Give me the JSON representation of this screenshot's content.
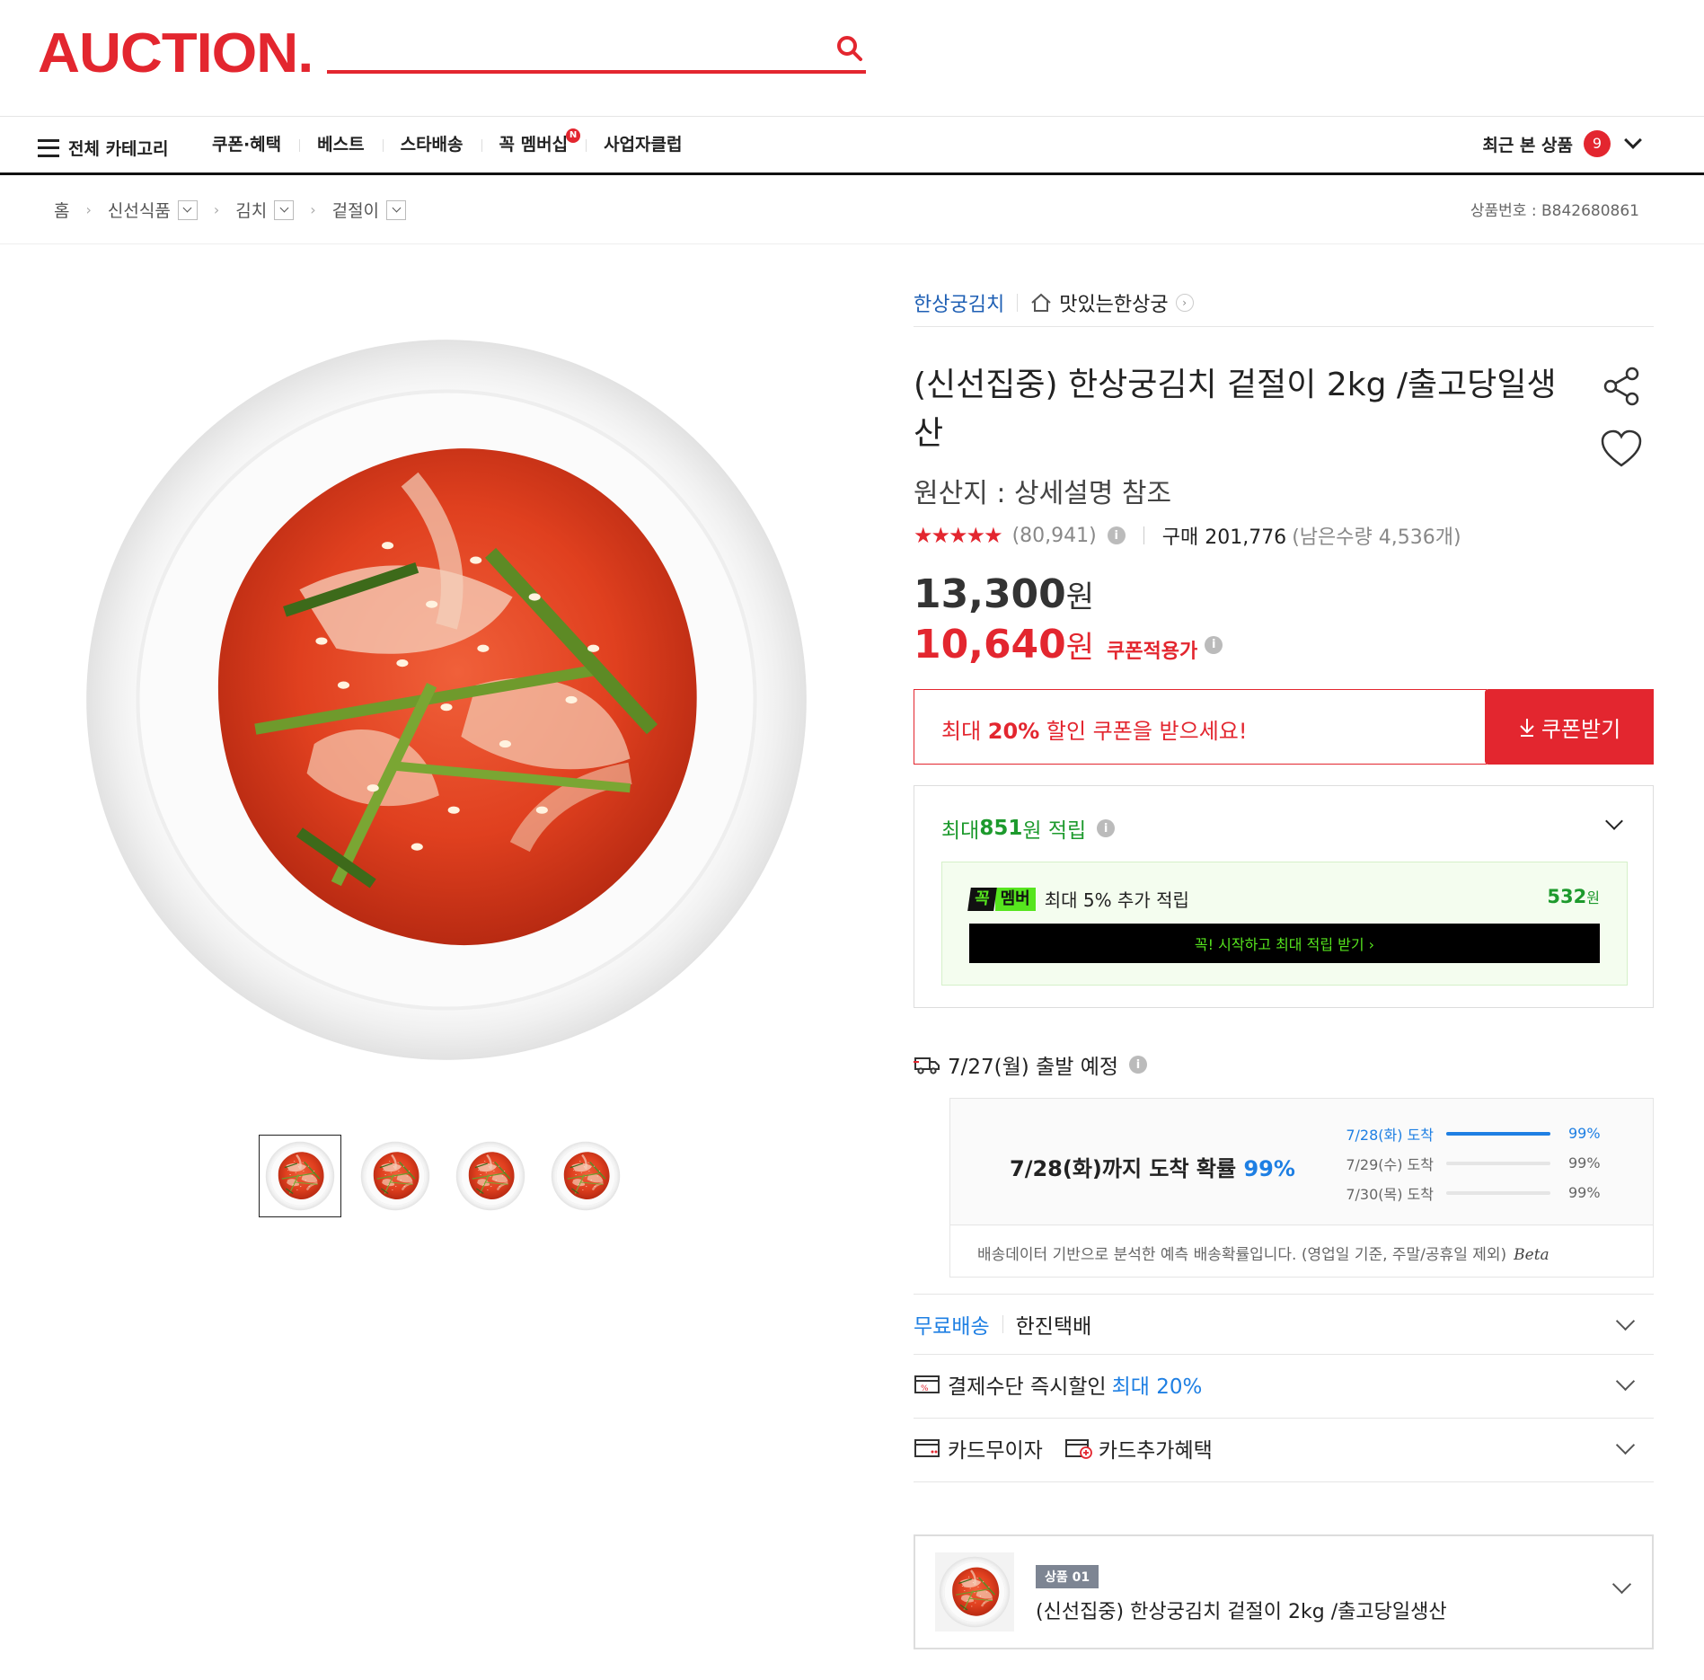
{
  "header": {
    "logo": "AUCTION.",
    "search_placeholder": "",
    "search_icon": "search-icon",
    "brand_color": "#e3262f"
  },
  "nav": {
    "all_category": "전체 카테고리",
    "items": [
      {
        "label": "쿠폰·혜택"
      },
      {
        "label": "베스트"
      },
      {
        "label": "스타배송"
      },
      {
        "label": "꼭 멤버십",
        "badge": "N"
      },
      {
        "label": "사업자클럽"
      }
    ],
    "recent_label": "최근 본 상품",
    "recent_count": "9"
  },
  "breadcrumb": {
    "items": [
      "홈",
      "신선식품",
      "김치",
      "겉절이"
    ],
    "product_no_label": "상품번호 : B842680861"
  },
  "gallery": {
    "thumbnail_count": 4
  },
  "product": {
    "brand": "한상궁김치",
    "store": "맛있는한상궁",
    "title": "(신선집중) 한상궁김치 겉절이 2kg /출고당일생산",
    "origin": "원산지 : 상세설명 참조",
    "stars": "★★★★★",
    "rating": 4.8,
    "review_count": "(80,941)",
    "buy_label": "구매 201,776",
    "remain_label": "(남은수량 4,536개)",
    "original_price": "13,300",
    "sale_price": "10,640",
    "won": "원",
    "coupon_price_label": "쿠폰적용가"
  },
  "coupon": {
    "msg_pre": "최대 ",
    "msg_bold": "20%",
    "msg_post": " 할인 쿠폰을 받으세요!",
    "button": "쿠폰받기"
  },
  "points": {
    "pre": "최대 ",
    "amount": "851",
    "post": "원 적립",
    "member_logo_a": "꼭",
    "member_logo_b": "멤버",
    "member_text": "최대 5% 추가 적립",
    "member_amount": "532",
    "member_won": "원",
    "member_button": "꼭! 시작하고 최대 적립 받기 ›"
  },
  "shipping": {
    "depart": "7/27(월) 출발 예정",
    "main_pre": "7/28(화)까지 도착 확률 ",
    "main_pct": "99%",
    "rows": [
      {
        "date": "7/28(화) 도착",
        "pct": "99%",
        "fill": 1.0
      },
      {
        "date": "7/29(수) 도착",
        "pct": "99%",
        "fill": 0
      },
      {
        "date": "7/30(목) 도착",
        "pct": "99%",
        "fill": 0
      }
    ],
    "note": "배송데이터 기반으로 분석한 예측 배송확률입니다. (영업일 기준, 주말/공휴일 제외)",
    "beta": "Beta",
    "accent": "#1e7fe3"
  },
  "options": {
    "free_ship": "무료배송",
    "courier": "한진택배",
    "pay_discount": "결제수단 즉시할인",
    "pay_discount_hi": "최대 20%",
    "card_noint": "카드무이자",
    "card_extra": "카드추가혜택"
  },
  "selected": {
    "badge": "상품 01",
    "title": "(신선집중) 한상궁김치 겉절이 2kg /출고당일생산"
  }
}
